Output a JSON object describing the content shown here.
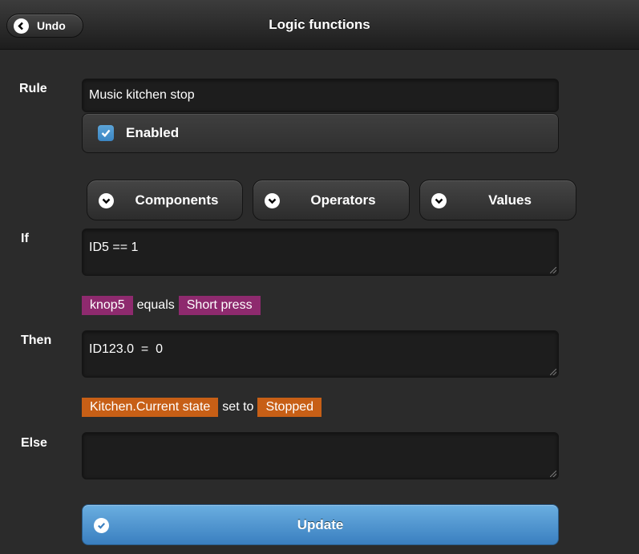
{
  "header": {
    "title": "Logic functions",
    "undo_label": "Undo"
  },
  "labels": {
    "rule": "Rule",
    "if": "If",
    "then": "Then",
    "else": "Else"
  },
  "rule": {
    "value": "Music kitchen stop",
    "enabled_label": "Enabled",
    "enabled": true
  },
  "selectors": [
    {
      "label": "Components",
      "icon": "chevron-down-icon"
    },
    {
      "label": "Operators",
      "icon": "chevron-down-icon"
    },
    {
      "label": "Values",
      "icon": "chevron-down-icon"
    }
  ],
  "if_field": {
    "value": "ID5 == 1"
  },
  "if_summary": {
    "component": "knop5",
    "operator": "equals",
    "value": "Short press",
    "color": "#8e2a6e"
  },
  "then_field": {
    "value": "ID123.0  =  0"
  },
  "then_summary": {
    "component": "Kitchen.Current state",
    "operator": "set to",
    "value": "Stopped",
    "color": "#c75f16"
  },
  "else_field": {
    "value": ""
  },
  "update_label": "Update",
  "colors": {
    "accent": "#4a94d2",
    "background": "#2b2b2b"
  }
}
